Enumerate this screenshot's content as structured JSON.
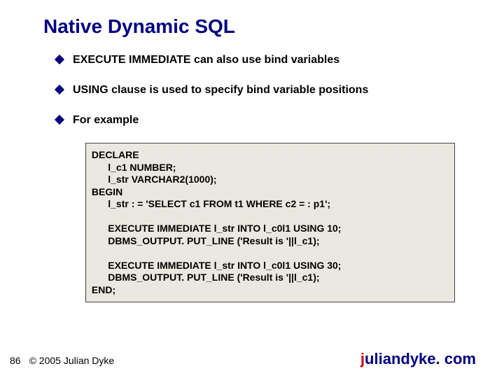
{
  "title": "Native Dynamic SQL",
  "bullets": [
    "EXECUTE IMMEDIATE can also use bind variables",
    "USING clause is used to specify bind variable positions",
    "For example"
  ],
  "code": " DECLARE\n       l_c1 NUMBER;\n       l_str VARCHAR2(1000);\n BEGIN\n       l_str : = 'SELECT c1 FROM t1 WHERE c2 = : p1';\n\n       EXECUTE IMMEDIATE l_str INTO l_c0l1 USING 10;\n       DBMS_OUTPUT. PUT_LINE ('Result is '||l_c1);\n\n       EXECUTE IMMEDIATE l_str INTO l_c0l1 USING 30;\n       DBMS_OUTPUT. PUT_LINE ('Result is '||l_c1);\n END;",
  "footer": {
    "page": "86",
    "copyright": "© 2005 Julian Dyke",
    "domain_first": "j",
    "domain_rest": "uliandyke. com"
  }
}
